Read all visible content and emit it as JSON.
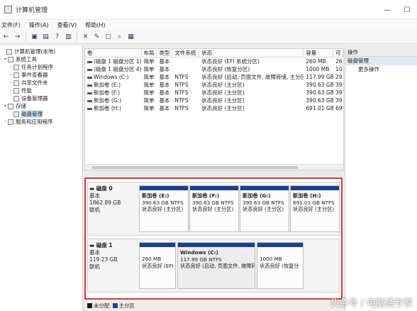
{
  "window": {
    "title": "计算机管理",
    "minimize": "—",
    "maximize": "☐"
  },
  "menu": [
    "文件(F)",
    "操作(A)",
    "查看(V)",
    "帮助(H)"
  ],
  "toolbar": [
    "←",
    "→",
    "▣",
    "▤",
    "?",
    "▥",
    "✕",
    "✎",
    "▢",
    "⌕",
    "▦"
  ],
  "tree": [
    {
      "label": "计算机管理(本地)",
      "level": 0,
      "toggle": ""
    },
    {
      "label": "系统工具",
      "level": 1,
      "toggle": "▾"
    },
    {
      "label": "任务计划程序",
      "level": 2,
      "toggle": "›"
    },
    {
      "label": "事件查看器",
      "level": 2,
      "toggle": "›"
    },
    {
      "label": "共享文件夹",
      "level": 2,
      "toggle": "›"
    },
    {
      "label": "性能",
      "level": 2,
      "toggle": "›"
    },
    {
      "label": "设备管理器",
      "level": 2,
      "toggle": ""
    },
    {
      "label": "存储",
      "level": 1,
      "toggle": "▾"
    },
    {
      "label": "磁盘管理",
      "level": 2,
      "toggle": "",
      "selected": true
    },
    {
      "label": "服务和应用程序",
      "level": 1,
      "toggle": "›"
    }
  ],
  "volumes": {
    "headers": [
      "卷",
      "布局",
      "类型",
      "文件系统",
      "状态",
      "容量",
      "可"
    ],
    "rows": [
      [
        "(磁盘 1 磁盘分区 1)",
        "简单",
        "基本",
        "",
        "状态良好 (EFI 系统分区)",
        "260 MB",
        "26"
      ],
      [
        "(磁盘 1 磁盘分区 4)",
        "简单",
        "基本",
        "",
        "状态良好 (恢复分区)",
        "1000 MB",
        "10"
      ],
      [
        "Windows (C:)",
        "简单",
        "基本",
        "NTFS",
        "状态良好 (启动, 页面文件, 故障转储, 主分区)",
        "117.99 GB",
        "29"
      ],
      [
        "新加卷 (E:)",
        "简单",
        "基本",
        "NTFS",
        "状态良好 (主分区)",
        "390.63 GB",
        "39"
      ],
      [
        "新加卷 (F:)",
        "简单",
        "基本",
        "NTFS",
        "状态良好 (主分区)",
        "390.63 GB",
        "39"
      ],
      [
        "新加卷 (G:)",
        "简单",
        "基本",
        "NTFS",
        "状态良好 (主分区)",
        "390.63 GB",
        "39"
      ],
      [
        "新加卷 (H:)",
        "简单",
        "基本",
        "NTFS",
        "状态良好 (主分区)",
        "691.01 GB",
        "69"
      ]
    ]
  },
  "actions": {
    "header": "操作",
    "section": "磁盘管理",
    "more": "更多操作"
  },
  "disk0": {
    "name": "磁盘 0",
    "type": "基本",
    "size": "1862.89 GB",
    "status": "联机",
    "partitions": [
      {
        "name": "新加卷 (E:)",
        "size": "390.63 GB NTFS",
        "status": "状态良好 (主分区)"
      },
      {
        "name": "新加卷 (F:)",
        "size": "390.63 GB NTFS",
        "status": "状态良好 (主分区)"
      },
      {
        "name": "新加卷 (G:)",
        "size": "390.63 GB NTFS",
        "status": "状态良好 (主分区)"
      },
      {
        "name": "新加卷 (H:)",
        "size": "691.01 GB NTFS",
        "status": "状态良好 (主分区)"
      }
    ]
  },
  "disk1": {
    "name": "磁盘 1",
    "type": "基本",
    "size": "119.23 GB",
    "status": "联机",
    "partitions": [
      {
        "name": "",
        "size": "260 MB",
        "status": "状态良好 (EFI"
      },
      {
        "name": "Windows (C:)",
        "size": "117.99 GB NTFS",
        "status": "状态良好 (启动, 页面文件, 故障转"
      },
      {
        "name": "",
        "size": "1000 MB",
        "status": "状态良好 (恢复分"
      }
    ]
  },
  "legend": [
    {
      "label": "未分配",
      "color": "#1a1a1a"
    },
    {
      "label": "主分区",
      "color": "#1c3f8f"
    }
  ],
  "watermark": "头条号 / 电脑通专家"
}
